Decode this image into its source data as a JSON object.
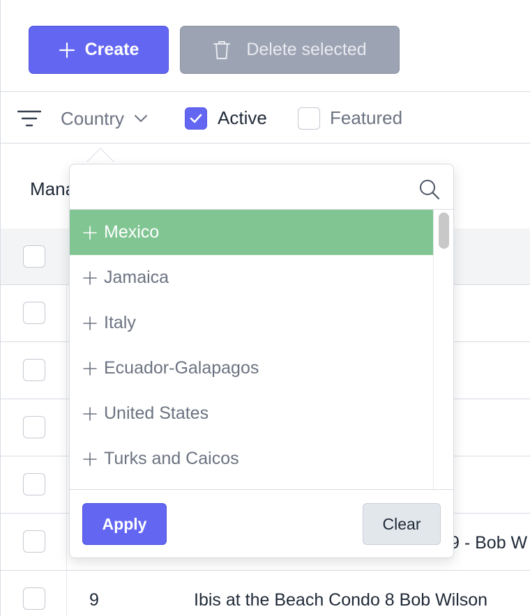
{
  "toolbar": {
    "create_label": "Create",
    "delete_label": "Delete selected"
  },
  "filters": {
    "country_label": "Country",
    "active_label": "Active",
    "active_checked": true,
    "featured_label": "Featured",
    "featured_checked": false
  },
  "page": {
    "title_partial": "Mana"
  },
  "table": {
    "rows": [
      {
        "id": "",
        "name": ""
      },
      {
        "id": "",
        "name": ""
      },
      {
        "id": "",
        "name": ""
      },
      {
        "id": "",
        "name": ""
      },
      {
        "id": "",
        "name": "9 - Bob W"
      },
      {
        "id": "9",
        "name": "Ibis at the Beach Condo 8 Bob Wilson"
      }
    ]
  },
  "country_dropdown": {
    "search_value": "",
    "options": [
      {
        "label": "Mexico",
        "selected": true
      },
      {
        "label": "Jamaica",
        "selected": false
      },
      {
        "label": "Italy",
        "selected": false
      },
      {
        "label": "Ecuador-Galapagos",
        "selected": false
      },
      {
        "label": "United States",
        "selected": false
      },
      {
        "label": "Turks and Caicos",
        "selected": false
      }
    ],
    "apply_label": "Apply",
    "clear_label": "Clear"
  },
  "colors": {
    "primary": "#6366f1",
    "disabled": "#9ca3b3",
    "selected_option": "#81c593"
  }
}
